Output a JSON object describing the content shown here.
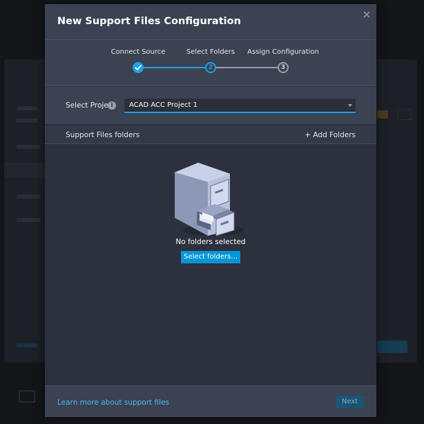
{
  "modal": {
    "title": "New Support Files Configuration",
    "close_label": "×"
  },
  "stepper": {
    "steps": [
      {
        "label": "Connect Source",
        "number": "1",
        "state": "completed"
      },
      {
        "label": "Select Folders",
        "number": "2",
        "state": "current"
      },
      {
        "label": "Assign Configuration",
        "number": "3",
        "state": "pending"
      }
    ]
  },
  "project": {
    "label": "Select Project",
    "info_icon": "i",
    "selected": "ACAD ACC Project 1"
  },
  "folders": {
    "title": "Support Files folders",
    "add_label": "+ Add Folders",
    "empty_text": "No folders selected",
    "select_button": "Select folders..."
  },
  "footer": {
    "learn_more": "Learn more about support files",
    "next_label": "Next"
  },
  "colors": {
    "accent": "#1ea0e6",
    "button_primary": "#0696d7",
    "link": "#4fb8f0",
    "modal_bg": "#2c313d",
    "header_bg": "#3b4252"
  },
  "icons": {
    "close": "close-icon",
    "check": "check-icon",
    "info": "info-icon",
    "cabinet": "file-cabinet-icon",
    "caret": "chevron-down-icon"
  }
}
